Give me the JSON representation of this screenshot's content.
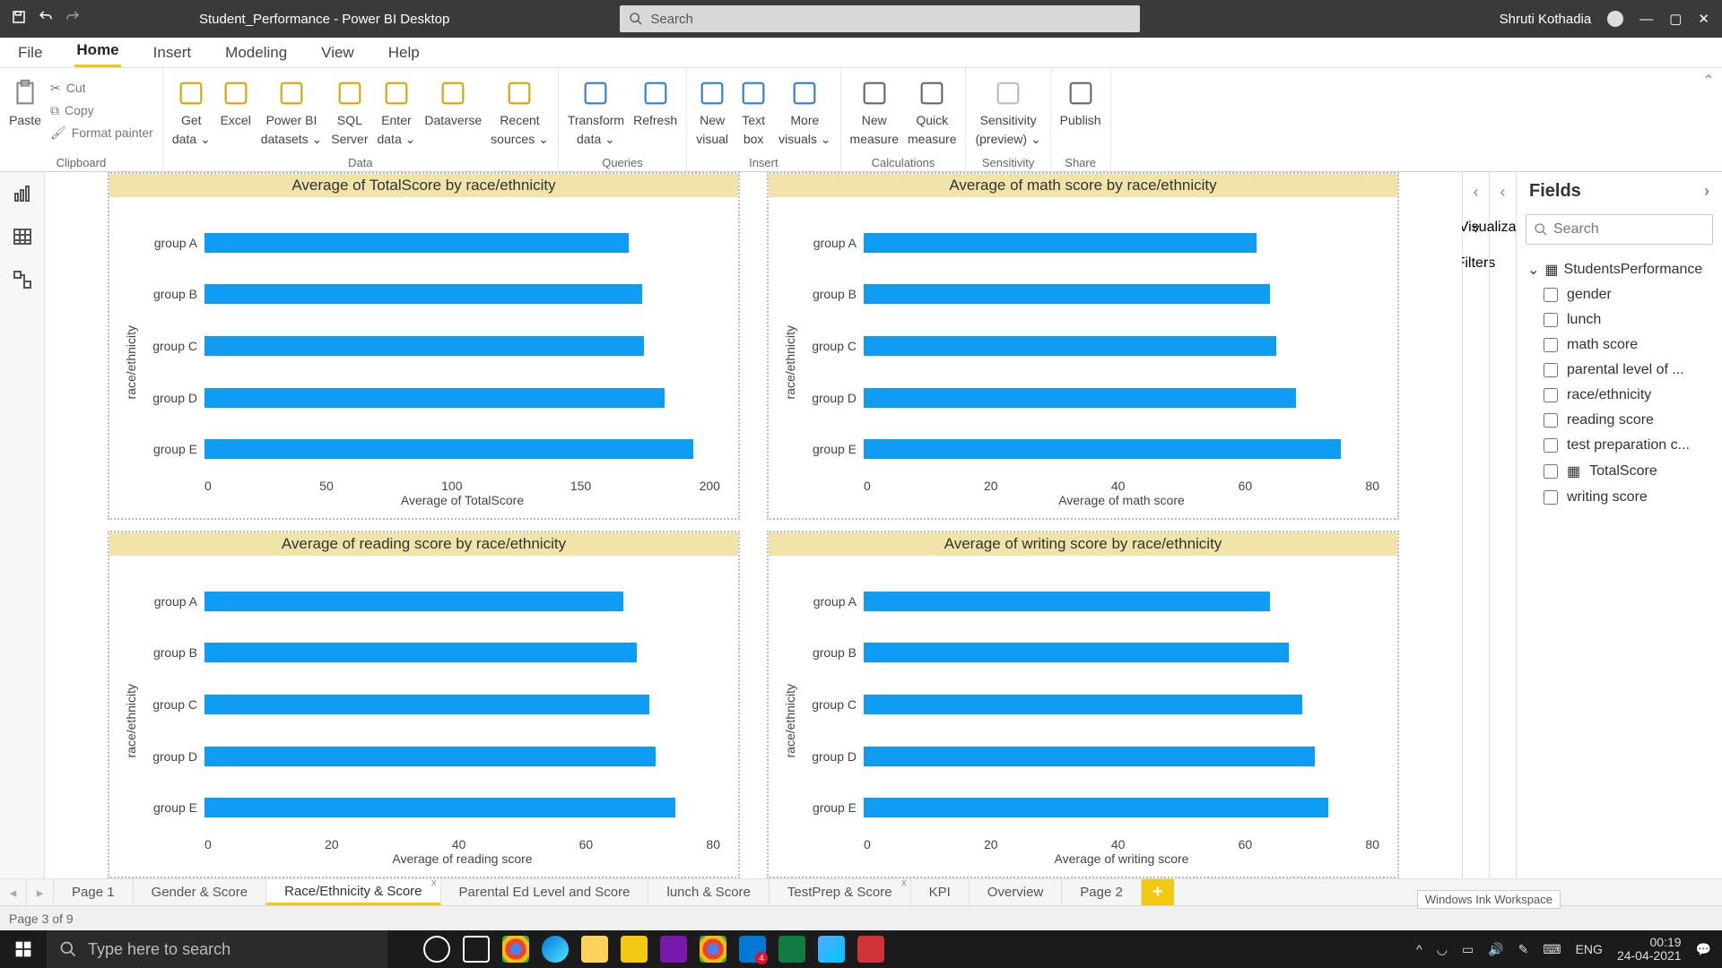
{
  "titlebar": {
    "app_title": "Student_Performance - Power BI Desktop",
    "search_placeholder": "Search",
    "user": "Shruti Kothadia"
  },
  "menubar": [
    "File",
    "Home",
    "Insert",
    "Modeling",
    "View",
    "Help"
  ],
  "menubar_active": 1,
  "ribbon": {
    "clipboard": {
      "paste": "Paste",
      "cut": "Cut",
      "copy": "Copy",
      "format": "Format painter",
      "label": "Clipboard"
    },
    "data": {
      "items": [
        {
          "l1": "Get",
          "l2": "data"
        },
        {
          "l1": "Excel",
          "l2": ""
        },
        {
          "l1": "Power BI",
          "l2": "datasets"
        },
        {
          "l1": "SQL",
          "l2": "Server"
        },
        {
          "l1": "Enter",
          "l2": "data"
        },
        {
          "l1": "Dataverse",
          "l2": ""
        },
        {
          "l1": "Recent",
          "l2": "sources"
        }
      ],
      "label": "Data"
    },
    "queries": {
      "items": [
        {
          "l1": "Transform",
          "l2": "data"
        },
        {
          "l1": "Refresh",
          "l2": ""
        }
      ],
      "label": "Queries"
    },
    "insert": {
      "items": [
        {
          "l1": "New",
          "l2": "visual"
        },
        {
          "l1": "Text",
          "l2": "box"
        },
        {
          "l1": "More",
          "l2": "visuals"
        }
      ],
      "label": "Insert"
    },
    "calculations": {
      "items": [
        {
          "l1": "New",
          "l2": "measure"
        },
        {
          "l1": "Quick",
          "l2": "measure"
        }
      ],
      "label": "Calculations"
    },
    "sensitivity": {
      "items": [
        {
          "l1": "Sensitivity",
          "l2": "(preview)"
        }
      ],
      "label": "Sensitivity"
    },
    "share": {
      "items": [
        {
          "l1": "Publish",
          "l2": ""
        }
      ],
      "label": "Share"
    }
  },
  "panes": {
    "filters": "Filters",
    "visualizations": "Visualizations",
    "fields": "Fields",
    "search_placeholder": "Search",
    "table": "StudentsPerformance",
    "field_list": [
      "gender",
      "lunch",
      "math score",
      "parental level of ...",
      "race/ethnicity",
      "reading score",
      "test preparation c...",
      "TotalScore",
      "writing score"
    ]
  },
  "tabs": {
    "pages": [
      "Page 1",
      "Gender & Score",
      "Race/Ethnicity & Score",
      "Parental Ed Level and Score",
      "lunch & Score",
      "TestPrep & Score",
      "KPI",
      "Overview",
      "Page 2"
    ],
    "closable": [
      false,
      false,
      true,
      false,
      false,
      true,
      false,
      false,
      false
    ],
    "active": 2
  },
  "status": {
    "page": "Page 3 of 9",
    "ink": "Windows Ink Workspace"
  },
  "taskbar": {
    "search": "Type here to search",
    "lang": "ENG",
    "time": "00:19",
    "date": "24-04-2021"
  },
  "chart_data": [
    {
      "type": "bar",
      "title": "Average of TotalScore by race/ethnicity",
      "ylabel": "race/ethnicity",
      "xlabel": "Average of TotalScore",
      "categories": [
        "group A",
        "group B",
        "group C",
        "group D",
        "group E"
      ],
      "values": [
        189,
        195,
        196,
        205,
        218
      ],
      "ticks": [
        "0",
        "50",
        "100",
        "150",
        "200"
      ],
      "xmax": 230
    },
    {
      "type": "bar",
      "title": "Average of math score by race/ethnicity",
      "ylabel": "race/ethnicity",
      "xlabel": "Average of math score",
      "categories": [
        "group A",
        "group B",
        "group C",
        "group D",
        "group E"
      ],
      "values": [
        61,
        63,
        64,
        67,
        74
      ],
      "ticks": [
        "0",
        "20",
        "40",
        "60",
        "80"
      ],
      "xmax": 80
    },
    {
      "type": "bar",
      "title": "Average of reading score by race/ethnicity",
      "ylabel": "race/ethnicity",
      "xlabel": "Average of reading score",
      "categories": [
        "group A",
        "group B",
        "group C",
        "group D",
        "group E"
      ],
      "values": [
        65,
        67,
        69,
        70,
        73
      ],
      "ticks": [
        "0",
        "20",
        "40",
        "60",
        "80"
      ],
      "xmax": 80
    },
    {
      "type": "bar",
      "title": "Average of writing score by race/ethnicity",
      "ylabel": "race/ethnicity",
      "xlabel": "Average of writing score",
      "categories": [
        "group A",
        "group B",
        "group C",
        "group D",
        "group E"
      ],
      "values": [
        63,
        66,
        68,
        70,
        72
      ],
      "ticks": [
        "0",
        "20",
        "40",
        "60",
        "80"
      ],
      "xmax": 80
    }
  ]
}
